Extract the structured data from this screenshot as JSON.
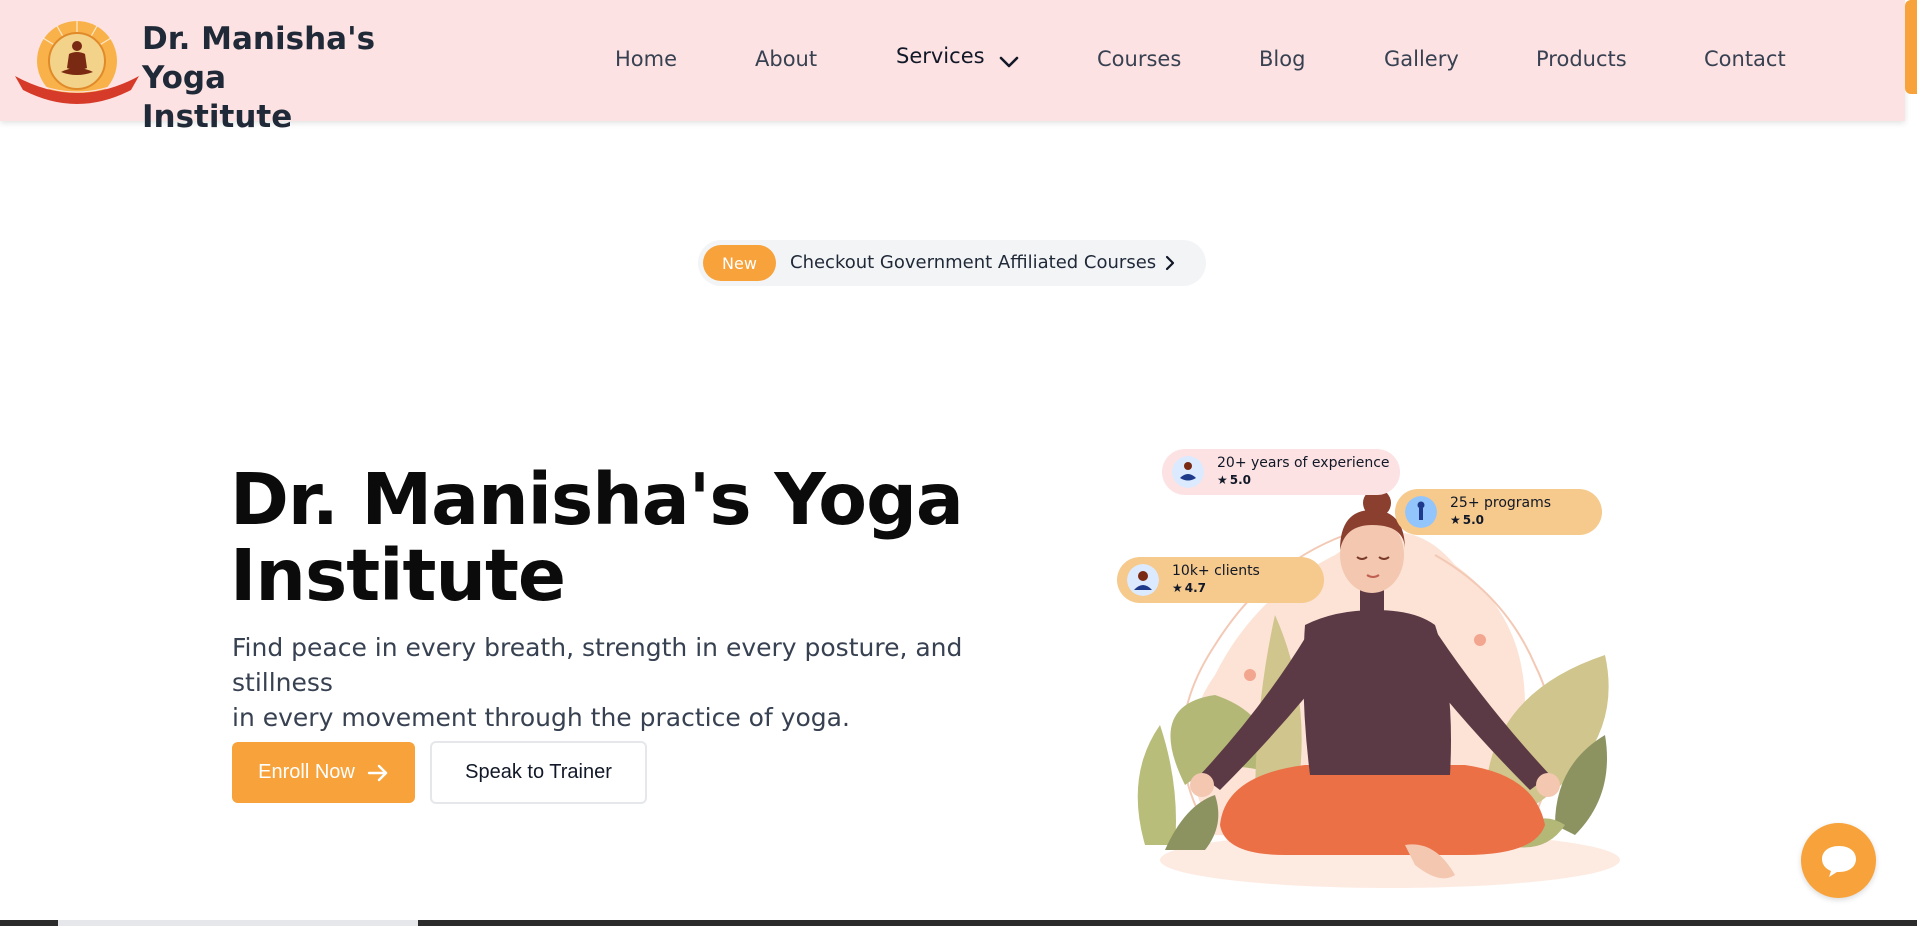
{
  "header": {
    "brand_line1": "Dr. Manisha's Yoga",
    "brand_line2": "Institute",
    "logo_icon": "yoga-institute-logo"
  },
  "nav": {
    "items": [
      {
        "label": "Home"
      },
      {
        "label": "About"
      },
      {
        "label": "Services"
      },
      {
        "label": "Courses"
      },
      {
        "label": "Blog"
      },
      {
        "label": "Gallery"
      },
      {
        "label": "Products"
      },
      {
        "label": "Contact"
      }
    ]
  },
  "announcement": {
    "badge": "New",
    "text": "Checkout Government Affiliated Courses"
  },
  "hero": {
    "title_line1": "Dr. Manisha's Yoga",
    "title_line2": "Institute",
    "subtitle_line1": "Find peace in every breath, strength in every posture, and stillness",
    "subtitle_line2": "in every movement through the practice of yoga.",
    "enroll_label": "Enroll Now",
    "trainer_label": "Speak to Trainer"
  },
  "stats": {
    "experience": {
      "label": "20+ years of experience",
      "rating": "5.0"
    },
    "programs": {
      "label": "25+ programs",
      "rating": "5.0"
    },
    "clients": {
      "label": "10k+ clients",
      "rating": "4.7"
    }
  },
  "colors": {
    "accent": "#f7a23a",
    "header_bg": "#fde2e3",
    "stat_peach": "#f6c98c"
  }
}
